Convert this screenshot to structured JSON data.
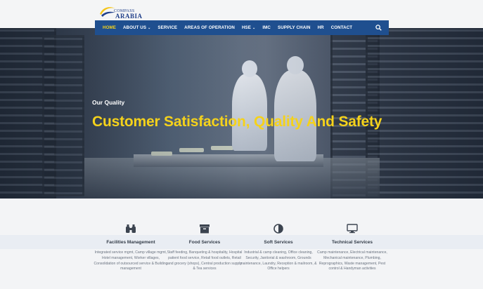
{
  "brand": {
    "line1": "COMPASS",
    "line2": "ARABIA"
  },
  "nav": {
    "items": [
      {
        "label": "HOME",
        "active": true,
        "caret": false
      },
      {
        "label": "ABOUT US",
        "caret": true
      },
      {
        "label": "SERVICE",
        "caret": false
      },
      {
        "label": "AREAS OF OPERATION",
        "caret": false
      },
      {
        "label": "HSE",
        "caret": true
      },
      {
        "label": "IMC",
        "caret": false
      },
      {
        "label": "SUPPLY CHAIN",
        "caret": false
      },
      {
        "label": "HR",
        "caret": false
      },
      {
        "label": "CONTACT",
        "caret": false
      }
    ],
    "caret_glyph": "⌄",
    "search_icon": "search-icon"
  },
  "hero": {
    "kicker": "Our Quality",
    "title": "Customer Satisfaction, Quality And Safety"
  },
  "services": [
    {
      "icon": "binoculars-icon",
      "title": "Facilities Management",
      "desc": "Integrated service mgmt, Camp village mgmt, Hotel management, Worker villages, Consolidation of outsourced service & Building management"
    },
    {
      "icon": "archive-box-icon",
      "title": "Food Services",
      "desc": "Staff feeding, Banqueting & hospitality, Hospital patient food service, Retail food outlets, Retail and grocery (shops), Central production supply & Tea services"
    },
    {
      "icon": "half-circle-icon",
      "title": "Soft Services",
      "desc": "Industrial & camp cleaning, Office cleaning, Security, Janitorial & washroom, Grounds maintenance, Laundry, Reception & mailroom, & Office helpers"
    },
    {
      "icon": "monitor-icon",
      "title": "Technical Services",
      "desc": "Camp maintenance, Electrical maintenance, Mechanical maintenance, Plumbing, Reprographics, Waste management, Pest control & Handyman activities"
    }
  ],
  "colors": {
    "nav_bg": "#1f4f8f",
    "accent": "#f5d21b",
    "brand_blue": "#21408a"
  }
}
